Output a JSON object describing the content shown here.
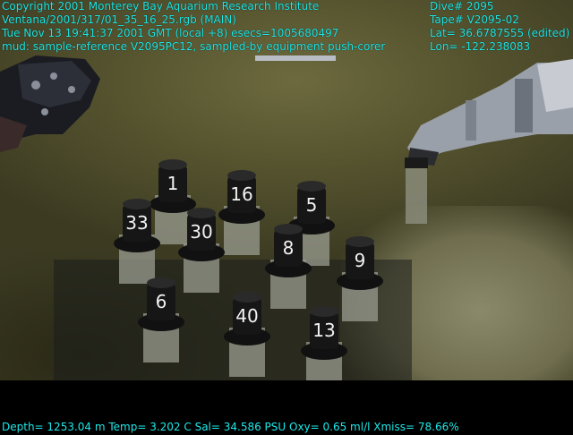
{
  "overlay": {
    "copyright": "Copyright 2001 Monterey Bay Aquarium Research Institute",
    "source_file": "Ventana/2001/317/01_35_16_25.rgb (MAIN)",
    "timestamp": "Tue Nov 13 19:41:37 2001 GMT (local +8)  esecs=1005680497",
    "annotation": "mud: sample-reference V2095PC12, sampled-by equipment push-corer",
    "dive": "Dive# 2095",
    "tape": "Tape# V2095-02",
    "lat": "Lat= 36.6787555 (edited)",
    "lon": "Lon= -122.238083",
    "telemetry": "Depth= 1253.04 m  Temp= 3.202 C  Sal= 34.586 PSU  Oxy= 0.65 ml/l  Xmiss= 78.66%"
  },
  "core_labels": [
    "1",
    "33",
    "16",
    "5",
    "30",
    "8",
    "9",
    "6",
    "40",
    "13"
  ],
  "colors": {
    "overlay_text": "#1ee6e6",
    "seafloor": "#57552f"
  }
}
